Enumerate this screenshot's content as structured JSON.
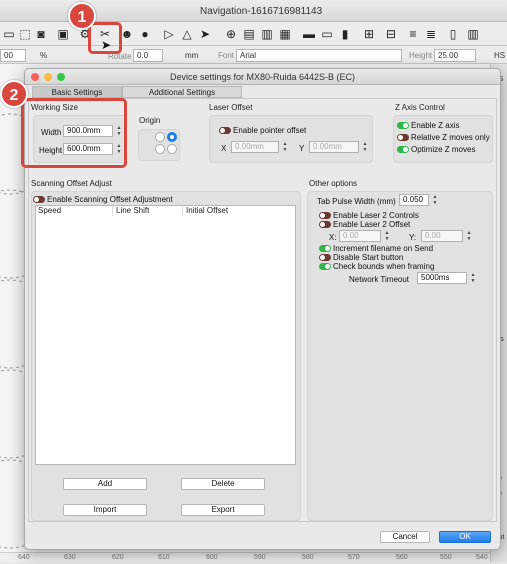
{
  "app": {
    "window_title": "Navigation-1616716981143",
    "zoom_value": "00",
    "zoom_unit": "%",
    "rotate_label": "Rotate",
    "rotate_value": "0.0",
    "mm_label": "mm",
    "font_label": "Font",
    "font_value": "Arial",
    "height_label": "Height",
    "height_value": "25.00",
    "hs_label": "HS",
    "right_panel_texts": [
      "VS",
      "ers",
      "ap",
      "gh",
      "h",
      "Aut"
    ],
    "ruler_ticks": [
      "640",
      "630",
      "620",
      "610",
      "600",
      "590",
      "580",
      "570",
      "560",
      "550",
      "540"
    ]
  },
  "callouts": [
    "1",
    "2"
  ],
  "dialog": {
    "title": "Device settings for MX80-Ruida 6442S-B (EC)",
    "tabs": [
      "Basic Settings",
      "Additional Settings"
    ],
    "working_size": {
      "label": "Working Size",
      "width_label": "Width",
      "width_value": "900.0mm",
      "height_label": "Height",
      "height_value": "600.0mm"
    },
    "origin": {
      "label": "Origin",
      "selected": "top-right"
    },
    "laser_offset": {
      "label": "Laser Offset",
      "enable_label": "Enable pointer offset",
      "enabled": false,
      "x_label": "X",
      "x_value": "0.00mm",
      "y_label": "Y",
      "y_value": "0.00mm"
    },
    "z_axis": {
      "label": "Z Axis Control",
      "options": [
        {
          "label": "Enable Z axis",
          "on": true
        },
        {
          "label": "Relative Z moves only",
          "on": false
        },
        {
          "label": "Optimize Z moves",
          "on": true
        }
      ]
    },
    "scanning_offset": {
      "label": "Scanning Offset Adjust",
      "enable_label": "Enable Scanning Offset Adjustment",
      "enabled": false,
      "columns": [
        "Speed",
        "Line Shift",
        "Initial Offset"
      ],
      "buttons": {
        "add": "Add",
        "delete": "Delete",
        "import": "Import",
        "export": "Export"
      }
    },
    "other_options": {
      "label": "Other options",
      "tab_pulse_label": "Tab Pulse Width (mm)",
      "tab_pulse_value": "0.050",
      "laser2_controls_label": "Enable Laser 2 Controls",
      "laser2_controls_on": false,
      "laser2_offset_label": "Enable Laser 2 Offset",
      "laser2_offset_on": false,
      "x_label": "X:",
      "x_value": "0.00",
      "y_label": "Y:",
      "y_value": "0.00",
      "increment_label": "Increment filename on Send",
      "increment_on": true,
      "disable_start_label": "Disable Start button",
      "disable_start_on": false,
      "check_bounds_label": "Check bounds when framing",
      "check_bounds_on": true,
      "timeout_label": "Network Timeout",
      "timeout_value": "5000ms"
    },
    "footer": {
      "cancel": "Cancel",
      "ok": "OK"
    }
  },
  "colors": {
    "accent_blue": "#1f7ee8",
    "toggle_on": "#2fb54a",
    "toggle_off": "#6a3a32",
    "callout_red": "#d9463d"
  }
}
